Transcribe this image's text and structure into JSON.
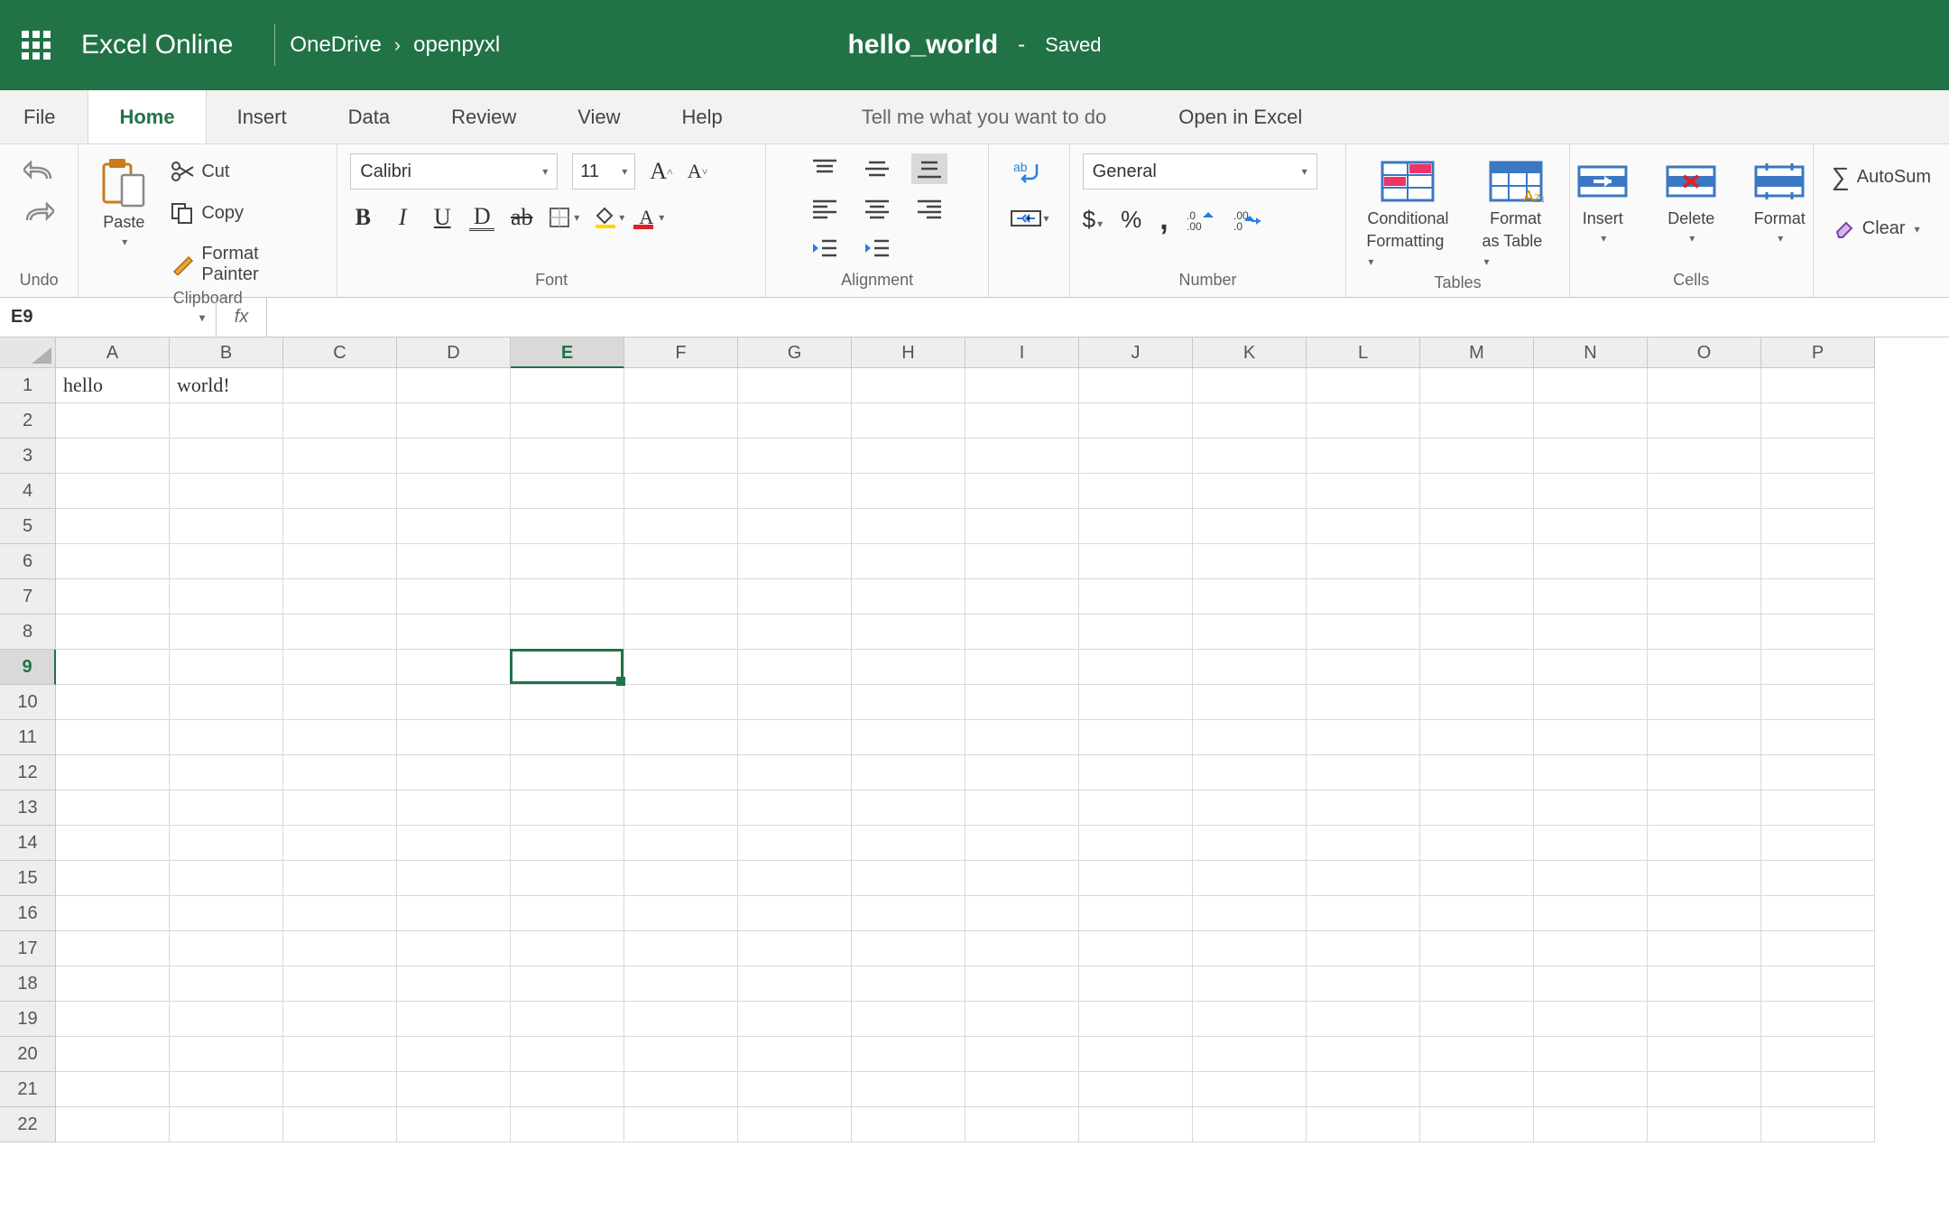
{
  "titlebar": {
    "app_name": "Excel Online",
    "breadcrumb": [
      "OneDrive",
      "openpyxl"
    ],
    "doc_name": "hello_world",
    "dash": "-",
    "status": "Saved"
  },
  "tabs": {
    "file": "File",
    "home": "Home",
    "insert": "Insert",
    "data": "Data",
    "review": "Review",
    "view": "View",
    "help": "Help",
    "tell_me": "Tell me what you want to do",
    "open_in": "Open in Excel"
  },
  "ribbon": {
    "undo_label": "Undo",
    "clipboard": {
      "paste": "Paste",
      "cut": "Cut",
      "copy": "Copy",
      "format_painter": "Format Painter",
      "label": "Clipboard"
    },
    "font": {
      "name": "Calibri",
      "size": "11",
      "label": "Font"
    },
    "alignment": {
      "label": "Alignment"
    },
    "number": {
      "format": "General",
      "label": "Number"
    },
    "tables": {
      "conditional1": "Conditional",
      "conditional2": "Formatting",
      "fmttable1": "Format",
      "fmttable2": "as Table",
      "label": "Tables"
    },
    "cells": {
      "insert": "Insert",
      "delete": "Delete",
      "format": "Format",
      "label": "Cells"
    },
    "editing": {
      "autosum": "AutoSum",
      "clear": "Clear"
    }
  },
  "fxrow": {
    "namebox": "E9",
    "fx": "fx",
    "formula": ""
  },
  "grid": {
    "columns": [
      "A",
      "B",
      "C",
      "D",
      "E",
      "F",
      "G",
      "H",
      "I",
      "J",
      "K",
      "L",
      "M",
      "N",
      "O",
      "P"
    ],
    "row_count": 22,
    "selected_col": "E",
    "selected_row": 9,
    "cells": {
      "A1": "hello",
      "B1": "world!"
    }
  }
}
